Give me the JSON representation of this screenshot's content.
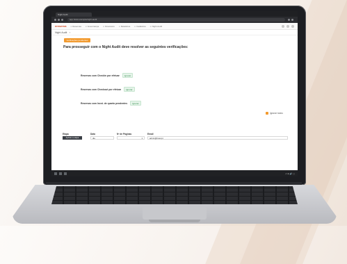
{
  "browser": {
    "tab_label": "Night Audit",
    "url": "app.hotel.example/night-audit"
  },
  "app": {
    "logo": "ereserva",
    "nav": [
      "Reservas",
      "Governança",
      "Financeiro",
      "Relatórios",
      "Cadastros",
      "Night Audit"
    ]
  },
  "page": {
    "subtab": "Night Audit",
    "warning_button": "Verificações pendentes",
    "heading": "Para prosseguir com o Night Audit deve resolver as seguintes verificações:",
    "checks": [
      {
        "label": "Reservas com Checkin por efetuar",
        "status": "Ignorar"
      },
      {
        "label": "Reservas com Checkout por efetuar",
        "status": "Ignorar"
      },
      {
        "label": "Reservas com Incst. de quarto pendentes",
        "status": "Ignorar"
      }
    ],
    "ignore_all": "Ignorar todos"
  },
  "form": {
    "labels": {
      "step": "Etapa",
      "date": "Data",
      "pages": "Nº de Páginas",
      "email": "Email"
    },
    "step_button": "Aplicar a etapa",
    "date_value": "dia",
    "pages_value": "1",
    "email_value": "admin@hotel.pt"
  },
  "taskbar": {
    "time": "∧ ⊕ 🔊 ▢"
  }
}
